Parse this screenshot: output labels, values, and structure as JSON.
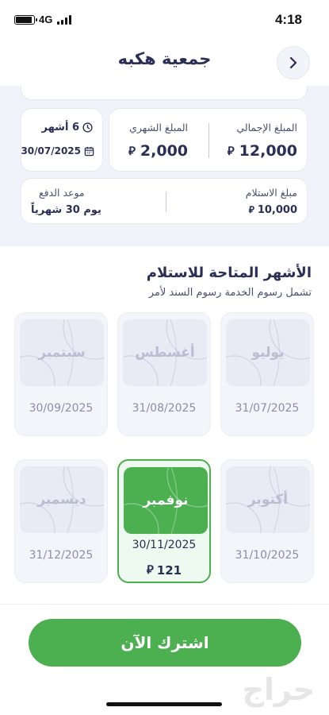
{
  "status_bar": {
    "time": "4:18",
    "network": "4G",
    "battery_level": 0.9
  },
  "header": {
    "title": "جمعية هكبه",
    "back_icon": "chevron-right-icon"
  },
  "summary": {
    "duration_value": "6 أشهر",
    "duration_icon": "clock-icon",
    "start_date": "30/07/2025",
    "calendar_icon": "calendar-icon",
    "total_label": "المبلغ الإجمالي",
    "total_value": "12,000",
    "monthly_label": "المبلغ الشهري",
    "monthly_value": "2,000",
    "receive_label": "مبلغ الاستلام",
    "receive_value": "10,000",
    "payment_label": "موعد الدفع",
    "payment_value": "يوم 30 شهرياً",
    "currency_symbol": "riyal-icon"
  },
  "months": {
    "title": "الأشهر المتاحة للاستلام",
    "subtitle": "تشمل رسوم الخدمة رسوم السند لأمر",
    "items": [
      {
        "name": "يوليو",
        "date": "31/07/2025",
        "selected": false
      },
      {
        "name": "أغسطس",
        "date": "31/08/2025",
        "selected": false
      },
      {
        "name": "سبتمبر",
        "date": "30/09/2025",
        "selected": false
      },
      {
        "name": "أكتوبر",
        "date": "31/10/2025",
        "selected": false
      },
      {
        "name": "نوفمبر",
        "date": "30/11/2025",
        "selected": true,
        "price": "121"
      },
      {
        "name": "ديسمبر",
        "date": "31/12/2025",
        "selected": false
      }
    ]
  },
  "footer": {
    "subscribe_label": "اشترك الآن",
    "watermark": "حراج"
  },
  "colors": {
    "accent": "#4caf50",
    "text": "#2b2f55",
    "background": "#f1f3fa"
  }
}
